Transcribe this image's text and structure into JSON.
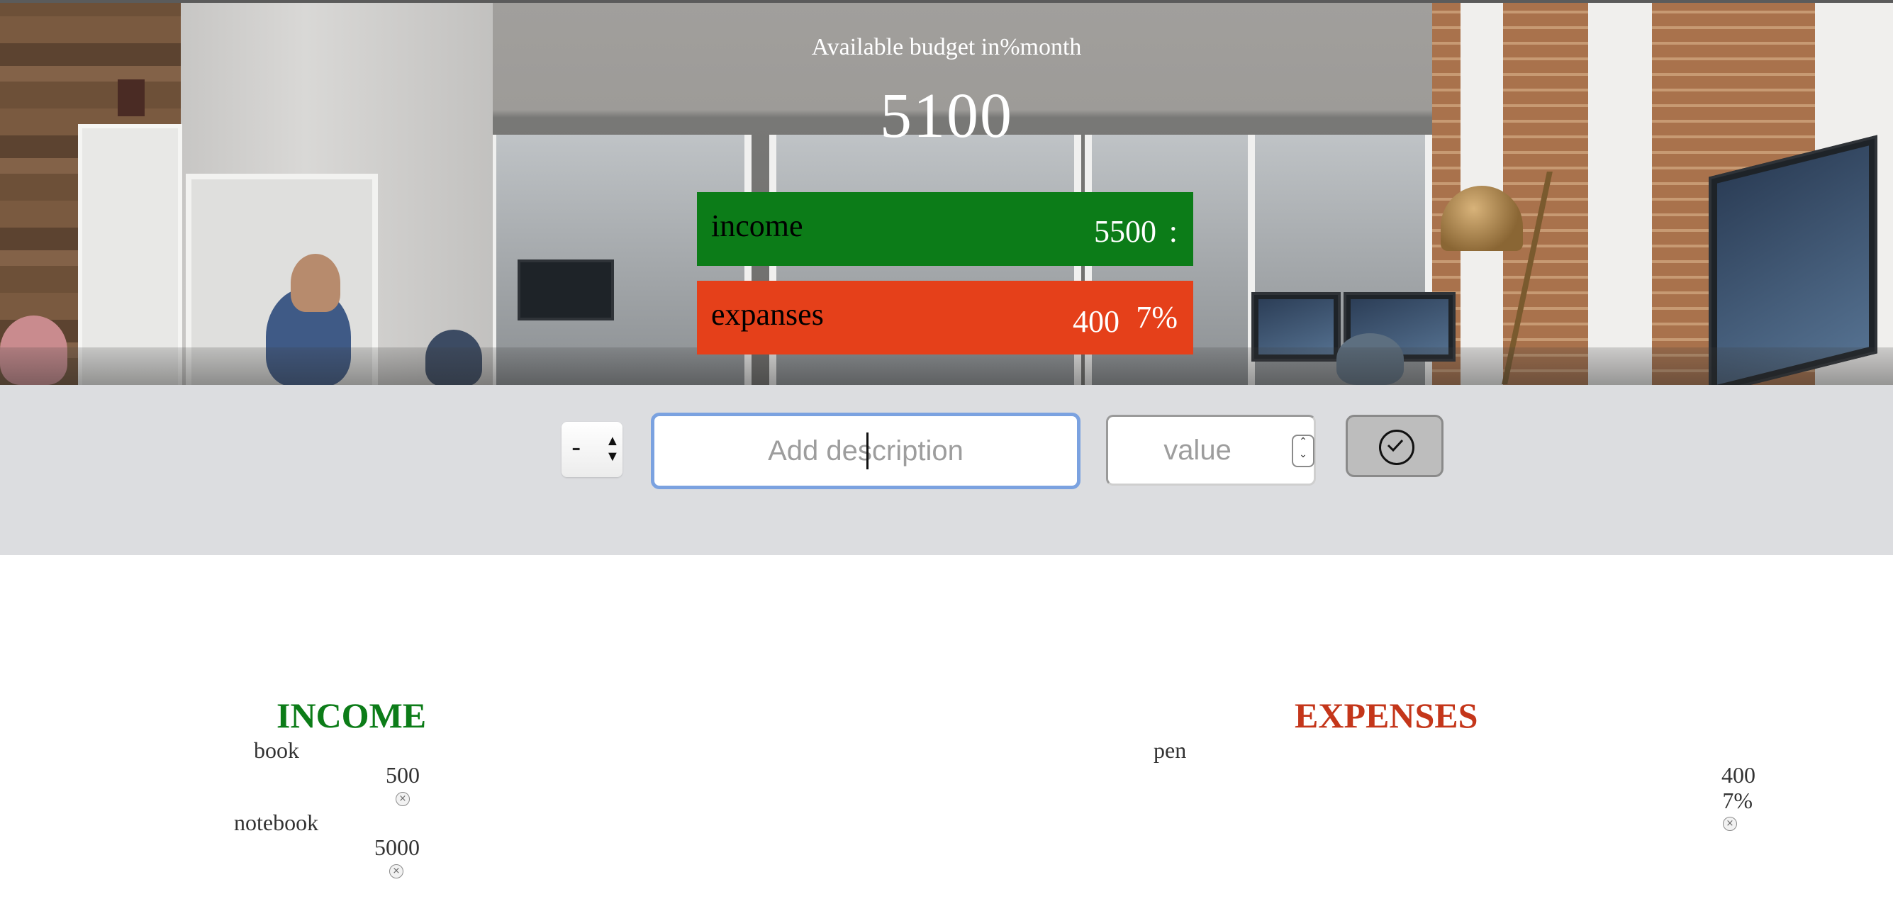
{
  "header": {
    "title": "Available budget in%month",
    "total": "5100"
  },
  "summary": {
    "income": {
      "label": "income",
      "value": "5500",
      "percent": ":",
      "color": "#0c7c18"
    },
    "expenses": {
      "label": "expanses",
      "value": "400",
      "percent": "7%",
      "color": "#e5401a"
    }
  },
  "form": {
    "type_value": "-",
    "description_placeholder": "Add description",
    "value_placeholder": "value",
    "submit_icon": "check-circle-icon"
  },
  "income": {
    "title": "INCOME",
    "color": "#0c7c18",
    "items": [
      {
        "description": "book",
        "value": "500"
      },
      {
        "description": "notebook",
        "value": "5000"
      }
    ]
  },
  "expenses": {
    "title": "EXPENSES",
    "color": "#c4361a",
    "items": [
      {
        "description": "pen",
        "value": "400",
        "percent": "7%"
      }
    ]
  }
}
